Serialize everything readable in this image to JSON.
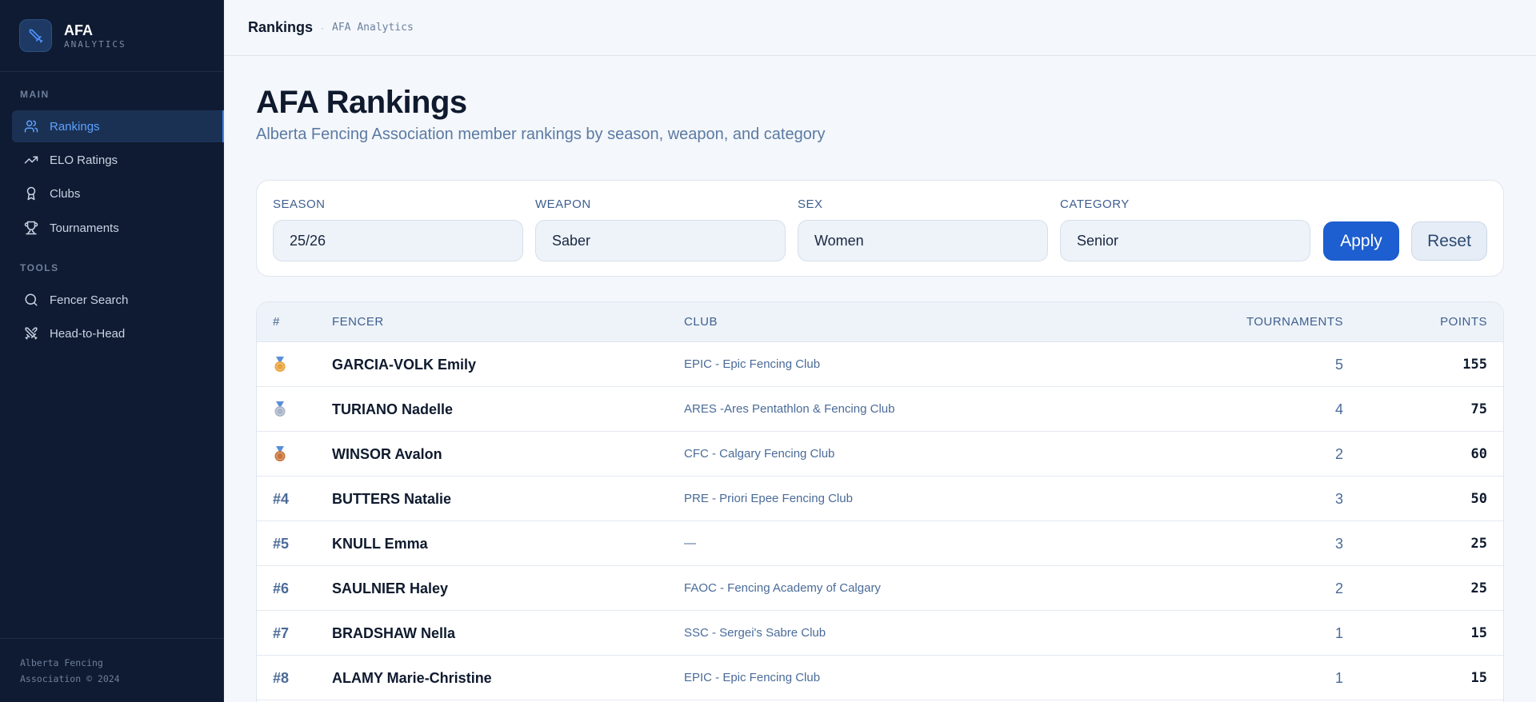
{
  "brand": {
    "name": "AFA",
    "sub": "ANALYTICS"
  },
  "sidebar": {
    "section_main": "MAIN",
    "section_tools": "TOOLS",
    "main_items": [
      {
        "label": "Rankings",
        "icon": "users-icon",
        "active": true
      },
      {
        "label": "ELO Ratings",
        "icon": "trend-up-icon"
      },
      {
        "label": "Clubs",
        "icon": "award-icon"
      },
      {
        "label": "Tournaments",
        "icon": "trophy-icon"
      }
    ],
    "tool_items": [
      {
        "label": "Fencer Search",
        "icon": "search-icon"
      },
      {
        "label": "Head-to-Head",
        "icon": "swords-icon"
      }
    ],
    "footer_line1": "Alberta Fencing",
    "footer_line2": "Association © 2024"
  },
  "topbar": {
    "title": "Rankings",
    "separator": "·",
    "sub": "AFA Analytics"
  },
  "page": {
    "title": "AFA Rankings",
    "subtitle": "Alberta Fencing Association member rankings by season, weapon, and category"
  },
  "filters": {
    "season": {
      "label": "SEASON",
      "value": "25/26"
    },
    "weapon": {
      "label": "WEAPON",
      "value": "Saber"
    },
    "sex": {
      "label": "SEX",
      "value": "Women"
    },
    "category": {
      "label": "CATEGORY",
      "value": "Senior"
    },
    "apply_label": "Apply",
    "reset_label": "Reset"
  },
  "table": {
    "headers": {
      "rank": "#",
      "fencer": "FENCER",
      "club": "CLUB",
      "tournaments": "TOURNAMENTS",
      "points": "POINTS"
    },
    "rows": [
      {
        "rank": "",
        "medal": "gold",
        "fencer": "GARCIA-VOLK Emily",
        "club": "EPIC - Epic Fencing Club",
        "tournaments": "5",
        "points": "155"
      },
      {
        "rank": "",
        "medal": "silver",
        "fencer": "TURIANO Nadelle",
        "club": "ARES -Ares Pentathlon & Fencing Club",
        "tournaments": "4",
        "points": "75"
      },
      {
        "rank": "",
        "medal": "bronze",
        "fencer": "WINSOR Avalon",
        "club": "CFC - Calgary Fencing Club",
        "tournaments": "2",
        "points": "60"
      },
      {
        "rank": "#4",
        "medal": "",
        "fencer": "BUTTERS Natalie",
        "club": "PRE - Priori Epee Fencing Club",
        "tournaments": "3",
        "points": "50"
      },
      {
        "rank": "#5",
        "medal": "",
        "fencer": "KNULL Emma",
        "club": "—",
        "tournaments": "3",
        "points": "25"
      },
      {
        "rank": "#6",
        "medal": "",
        "fencer": "SAULNIER Haley",
        "club": "FAOC - Fencing Academy of Calgary",
        "tournaments": "2",
        "points": "25"
      },
      {
        "rank": "#7",
        "medal": "",
        "fencer": "BRADSHAW Nella",
        "club": "SSC - Sergei's Sabre Club",
        "tournaments": "1",
        "points": "15"
      },
      {
        "rank": "#8",
        "medal": "",
        "fencer": "ALAMY Marie-Christine",
        "club": "EPIC - Epic Fencing Club",
        "tournaments": "1",
        "points": "15"
      }
    ]
  },
  "colors": {
    "sidebar_bg": "#0f1b32",
    "accent": "#1d5ed0",
    "active_nav": "#5da2ff",
    "gold": "#e9a23b",
    "silver": "#a8b4c8",
    "bronze": "#c8733a"
  }
}
